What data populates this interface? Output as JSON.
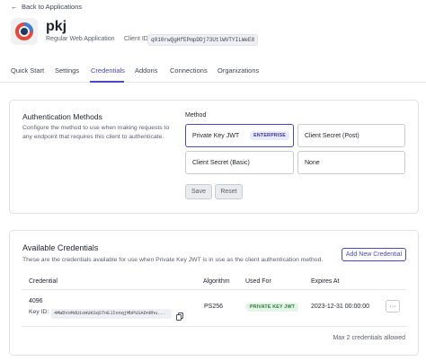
{
  "header": {
    "back_label": "Back to Applications",
    "app_name": "pkj",
    "app_type": "Regular Web Application",
    "client_id_label": "Client ID",
    "client_id_value": "q010rwQgHfEPmpDDj73UtlWVTYILWeE8"
  },
  "tabs": [
    {
      "label": "Quick Start"
    },
    {
      "label": "Settings"
    },
    {
      "label": "Credentials"
    },
    {
      "label": "Addons"
    },
    {
      "label": "Connections"
    },
    {
      "label": "Organizations"
    }
  ],
  "auth": {
    "title": "Authentication Methods",
    "description": "Configure the method to use when making requests to any endpoint that requires this client to authenticate.",
    "method_label": "Method",
    "methods": [
      {
        "label": "Private Key JWT",
        "badge": "ENTERPRISE"
      },
      {
        "label": "Client Secret (Post)"
      },
      {
        "label": "Client Secret (Basic)"
      },
      {
        "label": "None"
      }
    ],
    "save_label": "Save",
    "reset_label": "Reset"
  },
  "credentials": {
    "title": "Available Credentials",
    "description": "These are the credentials available for use when Private Key JWT is in use as the client authentication method.",
    "add_label": "Add New Credential",
    "columns": [
      "Credential",
      "Algorithm",
      "Used For",
      "Expires At"
    ],
    "rows": [
      {
        "name": "4096",
        "key_id_label": "Key ID:",
        "key_id": "4MWDVoMdU1oHUKSqSTnEJIonqjMbPUSADnRhu...",
        "algorithm": "PS256",
        "used_for": "PRIVATE KEY JWT",
        "expires_at": "2023-12-31 00:00:00"
      }
    ],
    "footer": "Max 2 credentials allowed"
  },
  "colors": {
    "accent": "#4a47c9",
    "badge_bg": "#e8e9ff",
    "success_bg": "#e4f5e8",
    "success_fg": "#2a7a3a"
  }
}
